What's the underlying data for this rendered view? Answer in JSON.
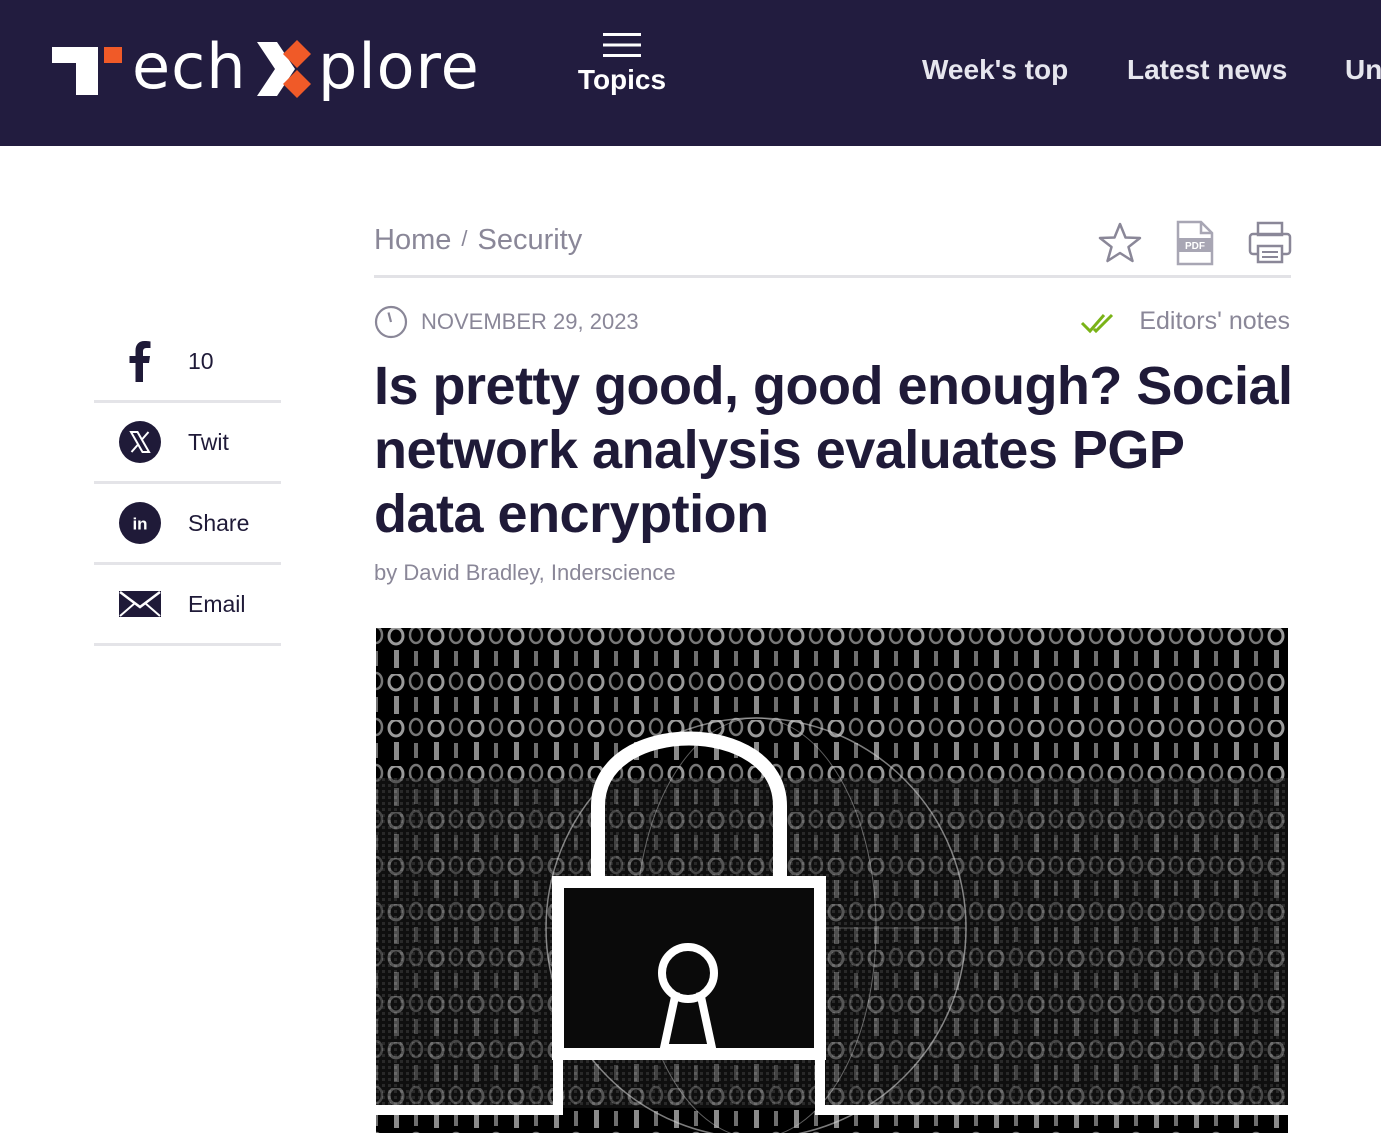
{
  "header": {
    "logo_text": "ech",
    "logo_text_2": "plore",
    "topics_label": "Topics",
    "nav": [
      "Week's top",
      "Latest news",
      "Un"
    ]
  },
  "colors": {
    "header_bg": "#221c3f",
    "logo_accent": "#f05a28",
    "editors_check": "#7ab317",
    "text_dark": "#1f1a38",
    "text_muted": "#8a8798"
  },
  "share": [
    {
      "icon": "facebook-icon",
      "label": "10"
    },
    {
      "icon": "x-twitter-icon",
      "label": "Twit"
    },
    {
      "icon": "linkedin-icon",
      "label": "Share"
    },
    {
      "icon": "email-icon",
      "label": "Email"
    }
  ],
  "breadcrumb": {
    "home": "Home",
    "separator": "/",
    "section": "Security"
  },
  "tools": [
    {
      "icon": "star-icon"
    },
    {
      "icon": "pdf-icon",
      "text": "PDF"
    },
    {
      "icon": "print-icon"
    }
  ],
  "article": {
    "date": "NOVEMBER 29, 2023",
    "editors_notes": "Editors' notes",
    "title": "Is pretty good, good enough? Social network analysis evaluates PGP data encryption",
    "byline": "by David Bradley, Inderscience",
    "image": {
      "subject": "padlock-over-binary-code",
      "style": "black-and-white"
    }
  }
}
